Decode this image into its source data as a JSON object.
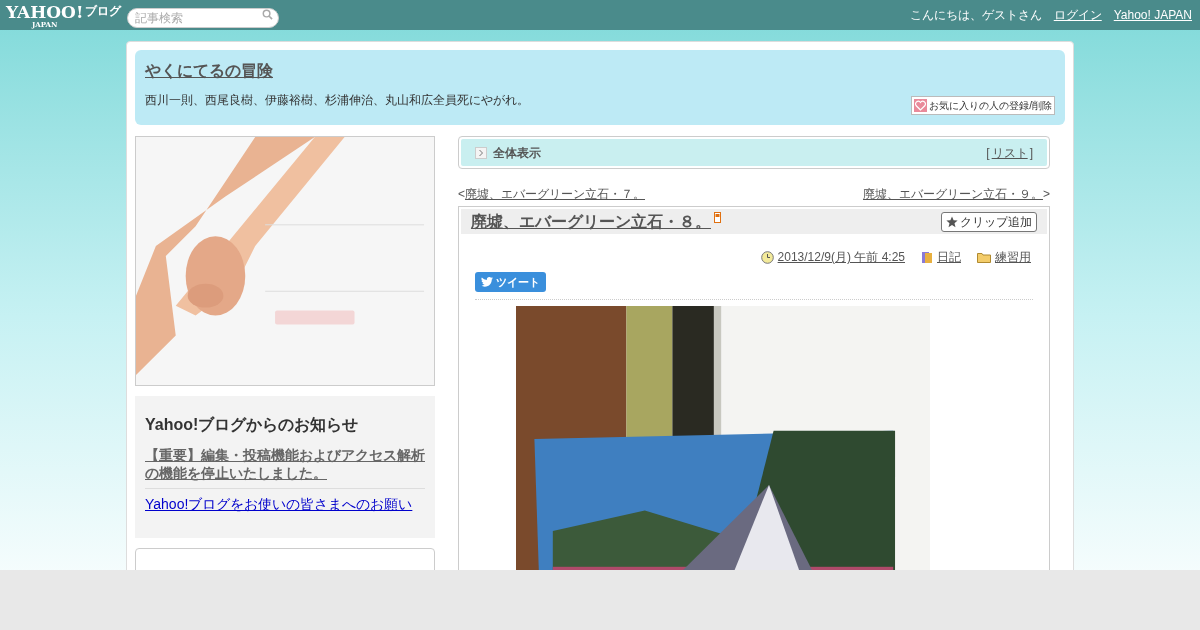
{
  "header": {
    "logo": "YAHOO!",
    "logo_sub": "JAPAN",
    "service": "ブログ",
    "search": {
      "placeholder": "記事検索"
    },
    "greeting": "こんにちは、ゲストさん",
    "links": [
      "ログイン",
      "Yahoo! JAPAN"
    ]
  },
  "blog": {
    "title": "やくにてるの冒険",
    "description": "西川一則、西尾良樹、伊藤裕樹、杉浦伸治、丸山和広全員死にやがれ。",
    "favorite_button": "お気に入りの人の登録/削除"
  },
  "notice": {
    "title": "Yahoo!ブログからのお知らせ",
    "items": [
      {
        "text": "【重要】編集・投稿機能およびアクセス解析の機能を停止いたしました。",
        "kind": "important"
      },
      {
        "text": "Yahoo!ブログをお使いの皆さまへのお願い",
        "kind": "link"
      }
    ]
  },
  "category_bar": {
    "label": "全体表示",
    "bracket_open": "[",
    "list_link": "リスト",
    "bracket_close": "]"
  },
  "nav": {
    "prev_mark": "<",
    "prev": "廃墟、エバーグリーン立石・７。",
    "next": "廃墟、エバーグリーン立石・９。",
    "next_mark": ">"
  },
  "post": {
    "title": "廃墟、エバーグリーン立石・８。",
    "clip_button": "クリップ追加",
    "date": "2013/12/9(月) 午前 4:25",
    "category": "日記",
    "folder": "練習用",
    "tweet": "ツイート"
  }
}
